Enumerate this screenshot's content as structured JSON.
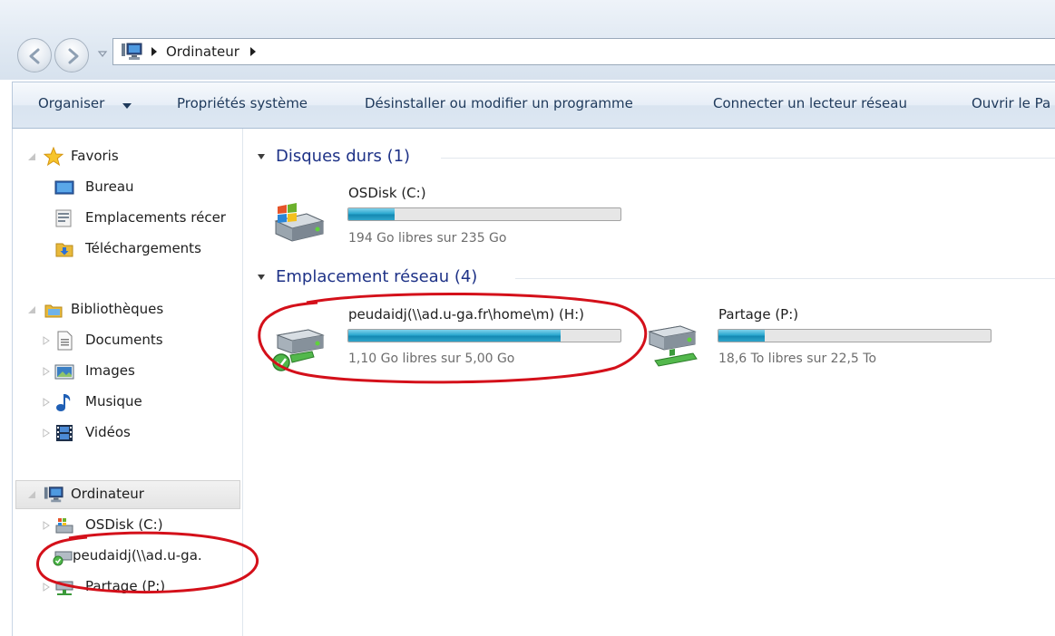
{
  "address": {
    "crumb": "Ordinateur"
  },
  "commands": {
    "organize": "Organiser",
    "system_properties": "Propriétés système",
    "uninstall": "Désinstaller ou modifier un programme",
    "map_drive": "Connecter un lecteur réseau",
    "open_control": "Ouvrir le Pa"
  },
  "nav": {
    "favorites": "Favoris",
    "desktop": "Bureau",
    "recent": "Emplacements récer",
    "downloads": "Téléchargements",
    "libraries": "Bibliothèques",
    "documents": "Documents",
    "images": "Images",
    "music": "Musique",
    "videos": "Vidéos",
    "computer": "Ordinateur",
    "osdisk": "OSDisk (C:)",
    "network_home": "peudaidj(\\\\ad.u-ga.",
    "share": "Partage (P:)"
  },
  "content": {
    "hard_disks_header": "Disques durs (1)",
    "network_header": "Emplacement réseau (4)",
    "drives": [
      {
        "name": "OSDisk (C:)",
        "free_text": "194 Go libres sur 235 Go",
        "used_fraction": 0.17
      },
      {
        "name": "peudaidj(\\\\ad.u-ga.fr\\home\\m) (H:)",
        "free_text": "1,10 Go libres sur 5,00 Go",
        "used_fraction": 0.78
      },
      {
        "name": "Partage (P:)",
        "free_text": "18,6 To libres sur 22,5 To",
        "used_fraction": 0.17
      }
    ]
  },
  "colors": {
    "annotation_red": "#d4101a",
    "group_header": "#1e3287",
    "bar_fill": "#1e96c3"
  }
}
